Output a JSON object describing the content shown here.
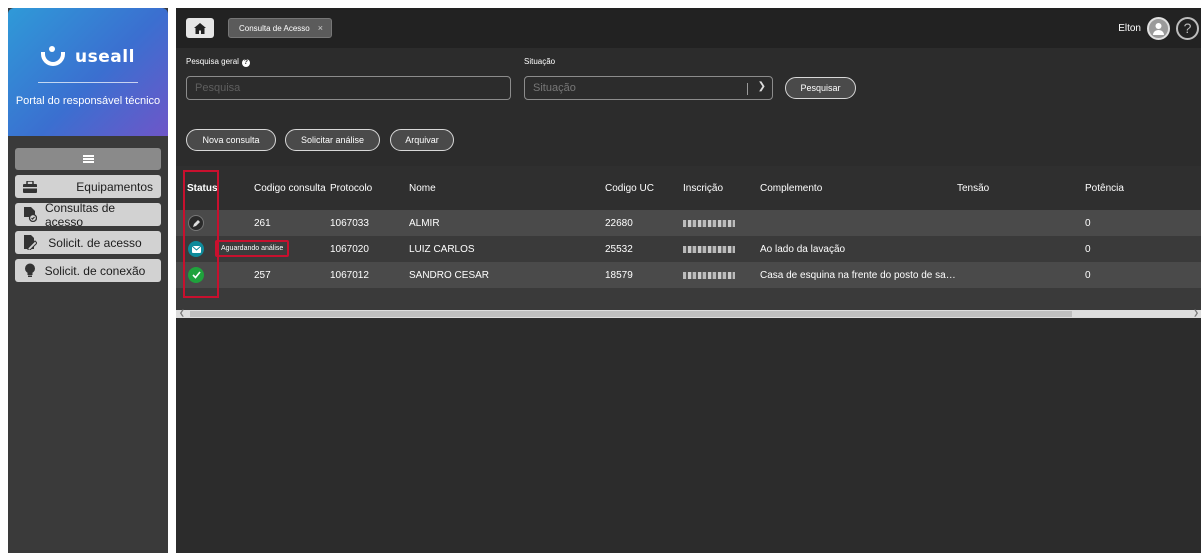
{
  "sidebar": {
    "brand_name": "useall",
    "portal_label": "Portal do responsável técnico",
    "items": [
      {
        "label": "Equipamentos",
        "icon": "toolbox-icon"
      },
      {
        "label": "Consultas de acesso",
        "icon": "document-check-icon"
      },
      {
        "label": "Solicit. de acesso",
        "icon": "document-edit-icon"
      },
      {
        "label": "Solicit. de conexão",
        "icon": "lightbulb-icon"
      }
    ]
  },
  "topbar": {
    "tab_label": "Consulta de Acesso",
    "tab_close": "×",
    "user_name": "Elton",
    "help_symbol": "?"
  },
  "filters": {
    "search_label": "Pesquisa geral",
    "search_placeholder": "Pesquisa",
    "status_label": "Situação",
    "status_placeholder": "Situação",
    "search_button": "Pesquisar"
  },
  "actions": {
    "new_query": "Nova consulta",
    "request_analysis": "Solicitar análise",
    "archive": "Arquivar"
  },
  "table": {
    "headers": {
      "status": "Status",
      "code": "Codigo consulta",
      "protocol": "Protocolo",
      "name": "Nome",
      "uc_code": "Codigo UC",
      "registration": "Inscrição",
      "complement": "Complemento",
      "voltage": "Tensão",
      "power": "Potência"
    },
    "rows": [
      {
        "status": "pencil",
        "code": "261",
        "protocol": "1067033",
        "name": "ALMIR",
        "uc_code": "22680",
        "complement": "",
        "voltage": "",
        "power": "0"
      },
      {
        "status": "envelope",
        "code": "",
        "protocol": "1067020",
        "name": "LUIZ CARLOS",
        "uc_code": "25532",
        "complement": "Ao lado da lavação",
        "voltage": "",
        "power": "0"
      },
      {
        "status": "check",
        "code": "257",
        "protocol": "1067012",
        "name": "SANDRO CESAR",
        "uc_code": "18579",
        "complement": "Casa de esquina na frente do posto de sa…",
        "voltage": "",
        "power": "0"
      }
    ],
    "tooltip": "Aguardando análise"
  },
  "colors": {
    "status_pencil": "#3d3d3d",
    "status_envelope": "#0e8a9a",
    "status_check": "#1fa23c",
    "highlight": "#c8102e"
  }
}
